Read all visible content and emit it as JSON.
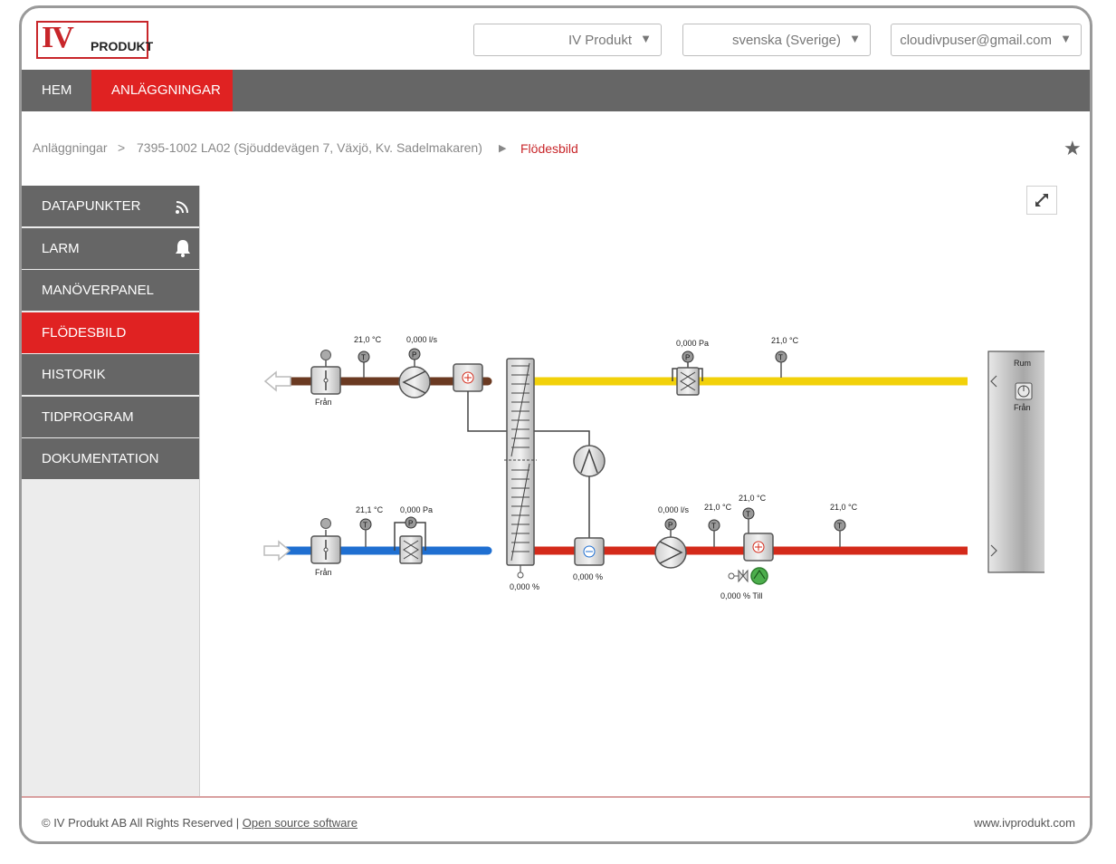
{
  "header": {
    "logo": {
      "iv": "IV",
      "produkt": "PRODUKT"
    },
    "company_select": "IV Produkt",
    "language_select": "svenska (Sverige)",
    "user_select": "cloudivpuser@gmail.com"
  },
  "nav": {
    "home": "HEM",
    "installations": "ANLÄGGNINGAR"
  },
  "breadcrumb": {
    "root": "Anläggningar",
    "sep1": ">",
    "installation": "7395-1002 LA02 (Sjöuddevägen 7, Växjö, Kv. Sadelmakaren)",
    "sep2": "▶",
    "current": "Flödesbild"
  },
  "sidebar": {
    "items": [
      {
        "label": "DATAPUNKTER",
        "icon": "rss-icon"
      },
      {
        "label": "LARM",
        "icon": "bell-icon"
      },
      {
        "label": "MANÖVERPANEL",
        "icon": ""
      },
      {
        "label": "FLÖDESBILD",
        "icon": ""
      },
      {
        "label": "HISTORIK",
        "icon": ""
      },
      {
        "label": "TIDPROGRAM",
        "icon": ""
      },
      {
        "label": "DOKUMENTATION",
        "icon": ""
      }
    ]
  },
  "diagram": {
    "exhaust_temp": "21,0 °C",
    "exhaust_flow": "0,000 l/s",
    "exhaust_damper_label": "Från",
    "extract_pressure": "0,000 Pa",
    "extract_temp": "21,0 °C",
    "room_label": "Rum",
    "room_switch_label": "Från",
    "outdoor_temp": "21,1 °C",
    "outdoor_pressure": "0,000 Pa",
    "outdoor_damper_label": "Från",
    "heat_exchanger_value": "0,000 %",
    "cooler_value": "0,000 %",
    "supply_flow": "0,000 l/s",
    "supply_temp_1": "21,0 °C",
    "supply_temp_2": "21,0 °C",
    "supply_temp_3": "21,0 °C",
    "heater_valve_value": "0,000 % Till"
  },
  "footer": {
    "copyright": "© IV Produkt AB All Rights Reserved |",
    "link": "Open source software",
    "website": "www.ivprodukt.com"
  },
  "colors": {
    "accent": "#e02222",
    "nav_bg": "#666666",
    "exhaust_duct": "#6b3a22",
    "extract_duct": "#f2d10a",
    "outdoor_duct": "#1f6fd1",
    "supply_duct": "#d42a1a"
  }
}
